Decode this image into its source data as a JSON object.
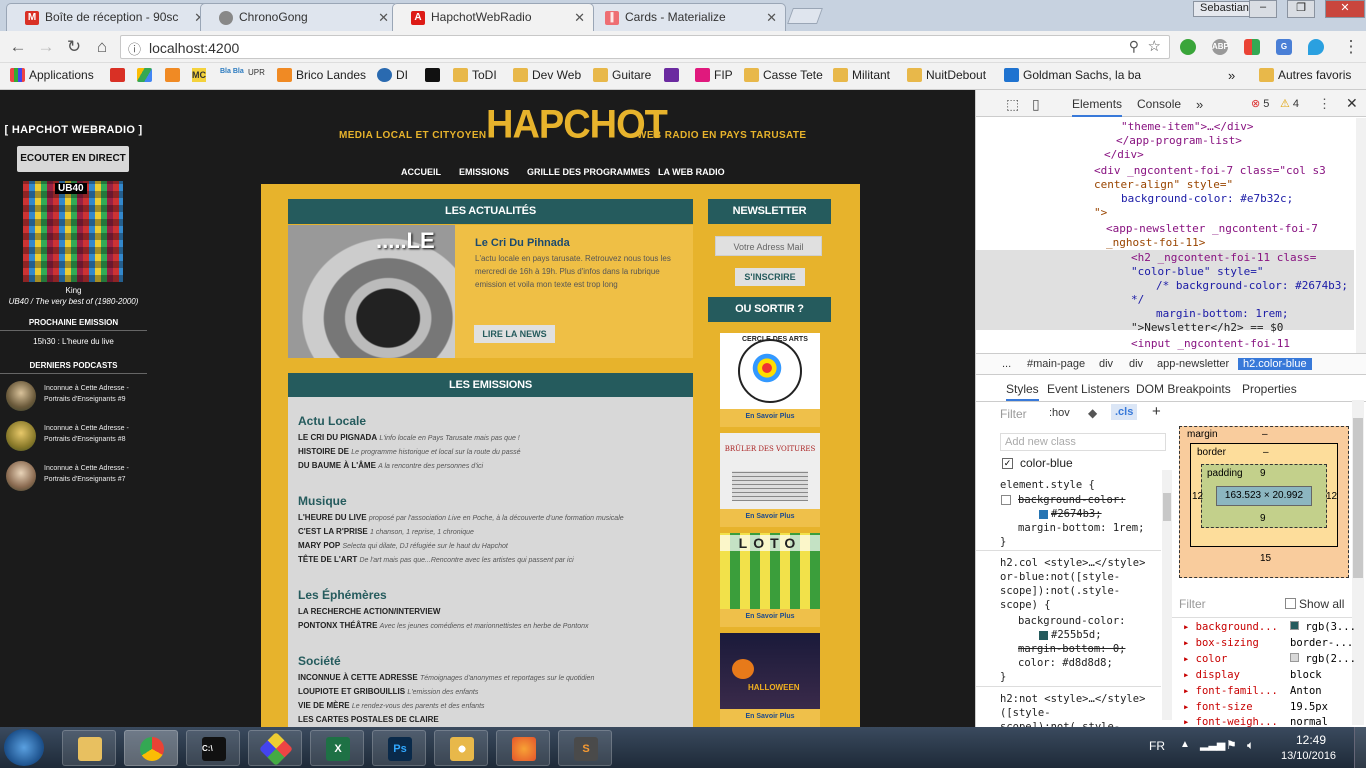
{
  "browser": {
    "tabs": [
      {
        "label": "Boîte de réception - 90sc",
        "icon": "gmail-icon"
      },
      {
        "label": "ChronoGong",
        "icon": "globe-icon"
      },
      {
        "label": "HapchotWebRadio",
        "icon": "angular-icon"
      },
      {
        "label": "Cards - Materialize",
        "icon": "materialize-icon"
      }
    ],
    "user": "Sebastian",
    "url": "localhost:4200",
    "bookmarks": [
      "Applications",
      "Brico Landes",
      "DI",
      "ToDI",
      "Dev Web",
      "Guitare",
      "FIP",
      "Casse Tete",
      "Militant",
      "NuitDebout",
      "Goldman Sachs, la ba",
      "Autres favoris"
    ],
    "bookmark_icon_labels": [
      "MC",
      "Bla Bla",
      "UPR"
    ]
  },
  "site": {
    "sidebar": {
      "title": "[ HAPCHOT WEBRADIO ]",
      "listen_button": "ECOUTER EN DIRECT",
      "cover_text": "UB40",
      "track_artist": "King",
      "track_album": "UB40 / The very best of (1980-2000)",
      "next_heading": "PROCHAINE EMISSION",
      "next_show": "15h30 : L'heure du live",
      "podcasts_heading": "DERNIERS PODCASTS",
      "podcasts": [
        {
          "line1": "Inconnue à Cette Adresse -",
          "line2": "Portraits d'Enseignants #9"
        },
        {
          "line1": "Inconnue à Cette Adresse -",
          "line2": "Portraits d'Enseignants #8"
        },
        {
          "line1": "Inconnue à Cette Adresse -",
          "line2": "Portraits d'Enseignants #7"
        }
      ]
    },
    "header": {
      "tagline_left": "MEDIA LOCAL ET CITYOYEN",
      "logo": "HAPCHOT",
      "tagline_right": "WEB RADIO EN PAYS TARUSATE"
    },
    "nav": [
      "ACCUEIL",
      "EMISSIONS",
      "GRILLE DES PROGRAMMES",
      "LA WEB RADIO"
    ],
    "news": {
      "heading": "LES ACTUALITÉS",
      "image_text": ".....LE",
      "title": "Le Cri Du Pihnada",
      "text": "L'actu locale en pays tarusate. Retrouvez nous tous les mercredi de 16h à 19h. Plus d'infos dans la rubrique emission et voila mon texte est trop long",
      "button": "LIRE LA NEWS"
    },
    "emissions": {
      "heading": "LES EMISSIONS",
      "categories": [
        {
          "name": "Actu Locale",
          "items": [
            {
              "title": "LE CRI DU PIGNADA",
              "desc": "L'info locale en Pays Tarusate mais pas que !"
            },
            {
              "title": "HISTOIRE DE",
              "desc": "Le programme historique et local sur la route du passé"
            },
            {
              "title": "DU BAUME À L'ÂME",
              "desc": "A la rencontre des personnes d'ici"
            }
          ]
        },
        {
          "name": "Musique",
          "items": [
            {
              "title": "L'HEURE DU LIVE",
              "desc": "proposé par l'association Live en Poche, à la découverte d'une formation musicale"
            },
            {
              "title": "C'EST LA R'PRISE",
              "desc": "1 chanson, 1 reprise, 1 chronique"
            },
            {
              "title": "MARY POP",
              "desc": "Selecta qui dilate, DJ réfugiée sur le haut du Hapchot"
            },
            {
              "title": "TÊTE DE L'ART",
              "desc": "De l'art mais pas que...Rencontre avec les artistes qui passent par ici"
            }
          ]
        },
        {
          "name": "Les Éphémères",
          "items": [
            {
              "title": "LA RECHERCHE ACTION/INTERVIEW",
              "desc": ""
            },
            {
              "title": "PONTONX THÉÂTRE",
              "desc": "Avec les jeunes comédiens et marionnettistes en herbe de Pontonx"
            }
          ]
        },
        {
          "name": "Société",
          "items": [
            {
              "title": "INCONNUE À CETTE ADRESSE",
              "desc": "Témoignages d'anonymes et reportages sur le quotidien"
            },
            {
              "title": "LOUPIOTE ET GRIBOUILLIS",
              "desc": "L'emission des enfants"
            },
            {
              "title": "VIE DE MÈRE",
              "desc": "Le rendez-vous des parents et des enfants"
            },
            {
              "title": "LES CARTES POSTALES DE CLAIRE",
              "desc": ""
            }
          ]
        }
      ]
    },
    "newsletter": {
      "heading": "NEWSLETTER",
      "input_placeholder": "Votre Adress Mail",
      "button": "S'INSCRIRE"
    },
    "outings": {
      "heading": "OU SORTIR ?",
      "items": [
        {
          "caption": "CERCLE DES ARTS",
          "link": "En Savoir Plus"
        },
        {
          "caption": "BRÛLER DES VOITURES",
          "link": "En Savoir Plus"
        },
        {
          "caption": "LOTO",
          "link": "En Savoir Plus"
        },
        {
          "caption": "HALLOWEEN",
          "link": "En Savoir Plus"
        }
      ]
    }
  },
  "devtools": {
    "tabs": [
      "Elements",
      "Console"
    ],
    "errors": "5",
    "warnings": "4",
    "dom_lines": [
      "\"theme-item\">…</div>",
      "</app-program-list>",
      "</div>",
      "<div _ngcontent-foi-7 class=\"col s3",
      "center-align\" style=\"",
      "background-color: #e7b32c;",
      "\">",
      "<app-newsletter _ngcontent-foi-7",
      "_nghost-foi-11>",
      "<h2 _ngcontent-foi-11 class=",
      "\"color-blue\" style=\"",
      "/* background-color: #2674b3;",
      "*/",
      "margin-bottom: 1rem;",
      "\">Newsletter</h2> == $0",
      "<input _ngcontent-foi-11"
    ],
    "breadcrumb": [
      "...",
      "#main-page",
      "div",
      "div",
      "app-newsletter",
      "h2.color-blue"
    ],
    "style_tabs": [
      "Styles",
      "Event Listeners",
      "DOM Breakpoints",
      "Properties"
    ],
    "filter_placeholder": "Filter",
    "hov": ":hov",
    "cls": ".cls",
    "add_class_placeholder": "Add new class",
    "class_checkbox": "color-blue",
    "rules": [
      "element.style {",
      "background-color:",
      "#2674b3;",
      "margin-bottom: 1rem;",
      "}",
      "h2.col  <style>…</style>",
      "or-blue:not([style-",
      "scope]):not(.style-",
      "scope) {",
      "background-color:",
      "#255b5d;",
      "margin-bottom: 0;",
      "color: #d8d8d8;",
      "}",
      "h2:not  <style>…</style>",
      "([style-",
      "scope]):not(.style-"
    ],
    "box_model": {
      "margin": "margin",
      "margin_dash": "–",
      "border": "border",
      "padding": "padding",
      "padding_val": "9",
      "left": "12",
      "right": "12",
      "content": "163.523 × 20.992",
      "bottom_padding": "9",
      "bottom_margin": "15"
    },
    "computed_filter": "Filter",
    "show_all": "Show all",
    "computed": [
      {
        "prop": "background...",
        "val": "rgb(3..."
      },
      {
        "prop": "box-sizing",
        "val": "border-..."
      },
      {
        "prop": "color",
        "val": "rgb(2..."
      },
      {
        "prop": "display",
        "val": "block"
      },
      {
        "prop": "font-famil...",
        "val": "Anton"
      },
      {
        "prop": "font-size",
        "val": "19.5px"
      },
      {
        "prop": "font-weigh...",
        "val": "normal"
      }
    ]
  },
  "taskbar": {
    "lang": "FR",
    "time": "12:49",
    "date": "13/10/2016"
  },
  "colors": {
    "gold": "#e7b32c",
    "teal": "#255b5d",
    "page_bg": "#1b1b1b"
  }
}
